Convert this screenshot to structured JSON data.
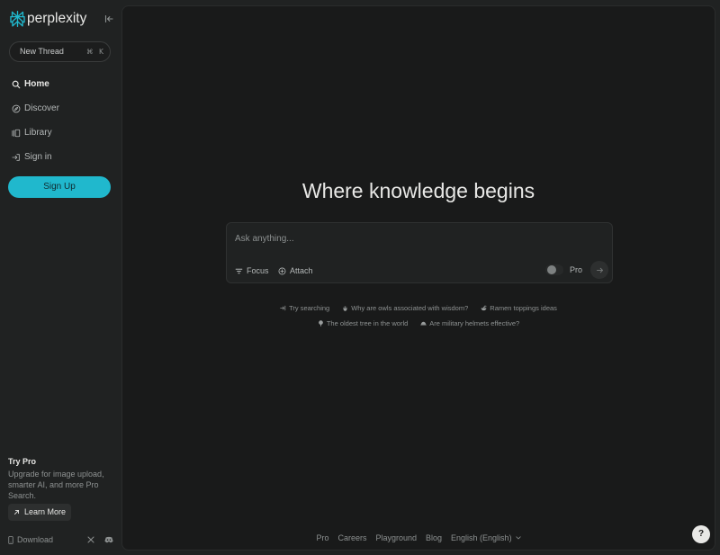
{
  "app": {
    "brand": "perplexity"
  },
  "colors": {
    "accent": "#20b8cd",
    "sidebar_bg": "#202222",
    "main_bg": "#191a1a",
    "text": "#e8e8e6",
    "muted": "#8d9191"
  },
  "sidebar": {
    "new_thread": {
      "label": "New Thread",
      "shortcut_mod": "⌘",
      "shortcut_key": "K"
    },
    "nav": [
      {
        "label": "Home",
        "icon": "search-icon"
      },
      {
        "label": "Discover",
        "icon": "compass-icon"
      },
      {
        "label": "Library",
        "icon": "library-icon"
      },
      {
        "label": "Sign in",
        "icon": "sign-in-icon"
      }
    ],
    "signup_label": "Sign Up",
    "promo": {
      "title": "Try Pro",
      "text": "Upgrade for image upload, smarter AI, and more Pro Search.",
      "button_label": "Learn More"
    },
    "footer": {
      "download_label": "Download"
    }
  },
  "main": {
    "headline": "Where knowledge begins",
    "search": {
      "placeholder": "Ask anything...",
      "focus_label": "Focus",
      "attach_label": "Attach",
      "pro_label": "Pro"
    },
    "suggestions": {
      "intro": "Try searching",
      "items": [
        {
          "label": "Why are owls associated with wisdom?",
          "icon": "owl-icon"
        },
        {
          "label": "Ramen toppings ideas",
          "icon": "ramen-bowl-icon"
        },
        {
          "label": "The oldest tree in the world",
          "icon": "tree-icon"
        },
        {
          "label": "Are military helmets effective?",
          "icon": "helmet-icon"
        }
      ]
    },
    "footer": {
      "links": [
        "Pro",
        "Careers",
        "Playground",
        "Blog"
      ],
      "language": "English (English)"
    },
    "help_label": "?"
  }
}
